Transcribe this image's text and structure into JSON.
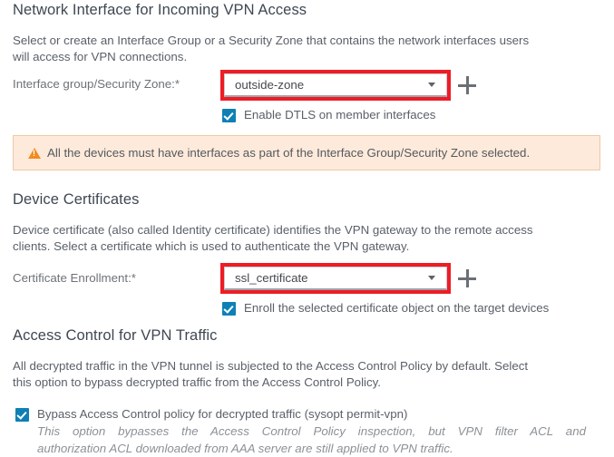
{
  "sections": {
    "network_interface": {
      "heading": "Network Interface for Incoming VPN Access",
      "description_line1": "Select or create an Interface Group or a Security Zone that contains the network interfaces users",
      "description_line2": "will access for VPN connections.",
      "field_label": "Interface group/Security Zone:*",
      "dropdown_value": "outside-zone",
      "add_button_label": "+",
      "checkbox": {
        "label": "Enable DTLS on member interfaces",
        "checked": true
      },
      "warning": "All the devices must have interfaces as part of the Interface Group/Security Zone selected."
    },
    "device_certificates": {
      "heading": "Device Certificates",
      "description_line1": "Device certificate (also called Identity certificate) identifies the VPN gateway to the remote access",
      "description_line2": "clients. Select a certificate which is used to authenticate the VPN gateway.",
      "field_label": "Certificate Enrollment:*",
      "dropdown_value": "ssl_certificate",
      "add_button_label": "+",
      "checkbox": {
        "label": "Enroll the selected certificate object on the target devices",
        "checked": true
      }
    },
    "access_control": {
      "heading": "Access Control for VPN Traffic",
      "description_line1": "All decrypted traffic in the VPN tunnel is subjected to the Access Control Policy by default. Select",
      "description_line2": "this option to bypass decrypted traffic from the Access Control Policy.",
      "checkbox": {
        "label": "Bypass Access Control policy for decrypted traffic (sysopt permit-vpn)",
        "checked": true
      },
      "note_line1": "This option bypasses the Access Control Policy inspection, but VPN filter ACL and",
      "note_line2": "authorization ACL downloaded from AAA server are still applied to VPN traffic."
    }
  },
  "colors": {
    "highlight_red": "#ee1c25",
    "checkbox_blue": "#0f80b5",
    "warning_bg": "#fdeadb",
    "warning_border": "#f0c9a4",
    "warning_icon": "#f28b22",
    "heading_text": "#3f4752",
    "body_text": "#5a6069"
  }
}
